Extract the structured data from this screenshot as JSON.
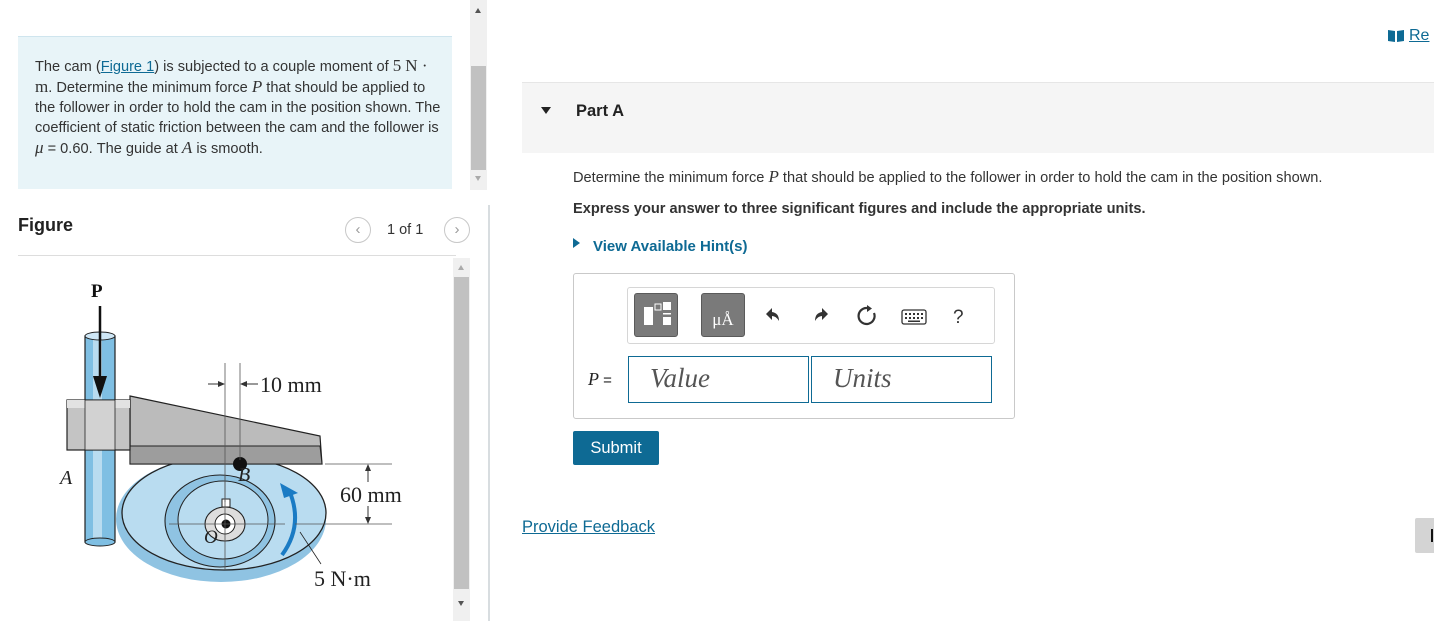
{
  "problem": {
    "text_1": "The cam (",
    "figure_link": "Figure 1",
    "text_2": ") is subjected to a couple moment of",
    "moment_value": "5",
    "moment_unit": "N · m",
    "text_3": ". Determine the minimum force",
    "force_var": "P",
    "text_4": "that should be applied to the follower in order to hold the cam in the position shown. The coefficient of static friction between the cam and the follower is",
    "mu_symbol": "μ",
    "mu_value": "= 0.60",
    "text_5": ". The guide at",
    "guide_var": "A",
    "text_6": "is smooth."
  },
  "figure_panel": {
    "title": "Figure",
    "pager": "1 of 1",
    "prev_icon": "chevron-left",
    "next_icon": "chevron-right",
    "labels": {
      "force": "P",
      "offset": "10 mm",
      "height": "60 mm",
      "moment": "5 N·m",
      "point_a": "A",
      "point_b": "B",
      "point_o": "O"
    }
  },
  "review_link": "Re",
  "part": {
    "title": "Part A",
    "question_1": "Determine the minimum force",
    "question_var": "P",
    "question_2": "that should be applied to the follower in order to hold the cam in the position shown.",
    "instruction": "Express your answer to three significant figures and include the appropriate units.",
    "hints_label": "View Available Hint(s)",
    "toolbar": {
      "templates_icon": "templates-icon",
      "symbols_label": "μÅ",
      "undo_icon": "undo-icon",
      "redo_icon": "redo-icon",
      "reset_icon": "reset-icon",
      "keyboard_icon": "keyboard-icon",
      "help_label": "?"
    },
    "answer_label": "P =",
    "value_placeholder": "Value",
    "units_placeholder": "Units",
    "submit_label": "Submit"
  },
  "feedback_label": "Provide Feedback",
  "colors": {
    "link": "#0e6a94",
    "problem_bg": "#e8f4f8",
    "submit_bg": "#0e6a94",
    "cam": "#b9dcf0",
    "rod": "#7fbfe3"
  }
}
